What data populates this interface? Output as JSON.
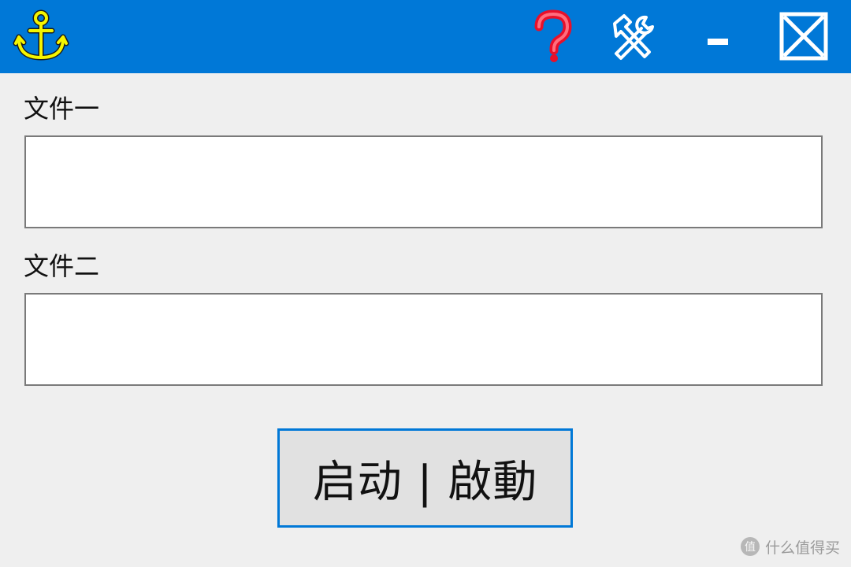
{
  "titlebar": {
    "background_color": "#0078d7",
    "app_icon": "anchor-icon",
    "app_icon_color": "#f5f500",
    "controls": {
      "help_icon": "question-mark-icon",
      "help_color": "#e8102a",
      "settings_icon": "tools-icon",
      "minimize_icon": "minimize-icon",
      "close_icon": "close-box-icon"
    }
  },
  "form": {
    "file1": {
      "label": "文件一",
      "value": "",
      "placeholder": ""
    },
    "file2": {
      "label": "文件二",
      "value": "",
      "placeholder": ""
    }
  },
  "actions": {
    "start_label": "启动 | 啟動",
    "start_border_color": "#0078d7"
  },
  "watermark": {
    "text": "什么值得买",
    "logo": "smzdm-logo-icon"
  }
}
